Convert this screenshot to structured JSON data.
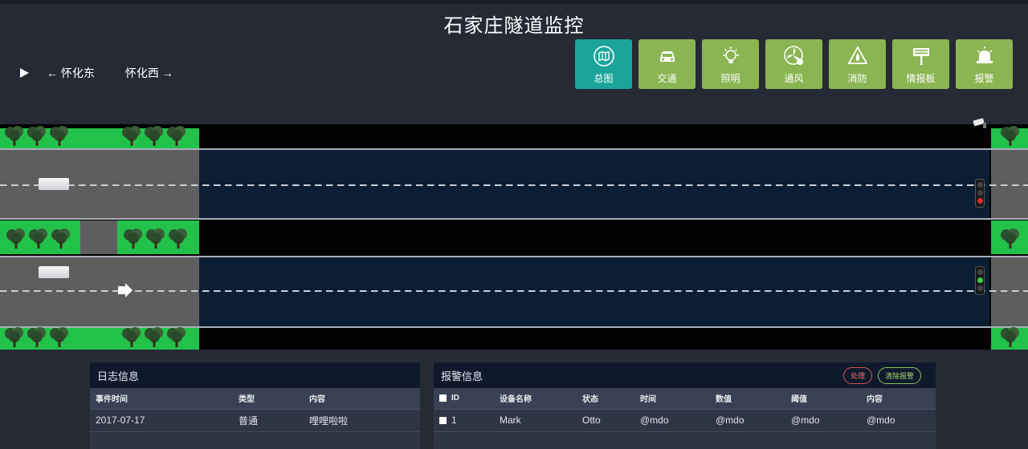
{
  "page": {
    "title": "石家庄隧道监控"
  },
  "direction_nav": {
    "east": "← 怀化东",
    "west": "怀化西 →"
  },
  "nav_buttons": [
    {
      "label": "总图",
      "icon": "map-icon",
      "active": true
    },
    {
      "label": "交通",
      "icon": "car-icon",
      "active": false
    },
    {
      "label": "照明",
      "icon": "lightbulb-icon",
      "active": false
    },
    {
      "label": "通风",
      "icon": "fan-icon",
      "active": false
    },
    {
      "label": "消防",
      "icon": "fire-icon",
      "active": false
    },
    {
      "label": "情报板",
      "icon": "info-board-icon",
      "active": false
    },
    {
      "label": "报警",
      "icon": "alarm-icon",
      "active": false
    }
  ],
  "colors": {
    "active_nav": "#1ba59a",
    "nav": "#8ab552",
    "grass": "#22c24a",
    "tunnel": "#0c1e33"
  },
  "log_panel": {
    "title": "日志信息",
    "columns": [
      "事件时间",
      "类型",
      "内容"
    ],
    "rows": [
      [
        "2017-07-17",
        "普通",
        "哩哩啦啦"
      ]
    ]
  },
  "alarm_panel": {
    "title": "报警信息",
    "handle_label": "处理",
    "clear_label": "清除报警",
    "columns": [
      "ID",
      "设备名称",
      "状态",
      "时间",
      "数值",
      "阈值",
      "内容"
    ],
    "rows": [
      [
        "1",
        "Mark",
        "Otto",
        "@mdo",
        "@mdo",
        "@mdo",
        "@mdo"
      ]
    ]
  }
}
